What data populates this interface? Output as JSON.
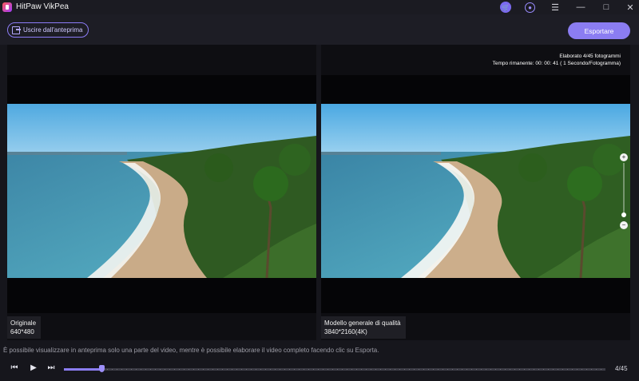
{
  "window": {
    "title": "HitPaw VikPea",
    "icons": [
      "cart-icon",
      "user-icon",
      "menu-icon",
      "minimize-icon",
      "maximize-icon",
      "close-icon"
    ]
  },
  "toolbar": {
    "exit_label": "Uscire dall'anteprima",
    "export_label": "Esportare"
  },
  "preview": {
    "left": {
      "title": "Originale",
      "resolution": "640*480"
    },
    "right": {
      "title": "Modello generale di qualità",
      "resolution": "3840*2160(4K)",
      "processed": "Elaborato 4/45 fotogrammi",
      "remaining": "Tempo rimanente: 00: 00: 41 ( 1 Secondo/Fotogramma)"
    }
  },
  "notice": "È possibile visualizzare in anteprima solo una parte del video, mentre è possibile elaborare il video completo facendo clic su Esporta.",
  "player": {
    "frame_label": "4/45",
    "progress_fraction": 0.0689
  },
  "colors": {
    "accent": "#8b7df2",
    "background": "#16161c"
  }
}
